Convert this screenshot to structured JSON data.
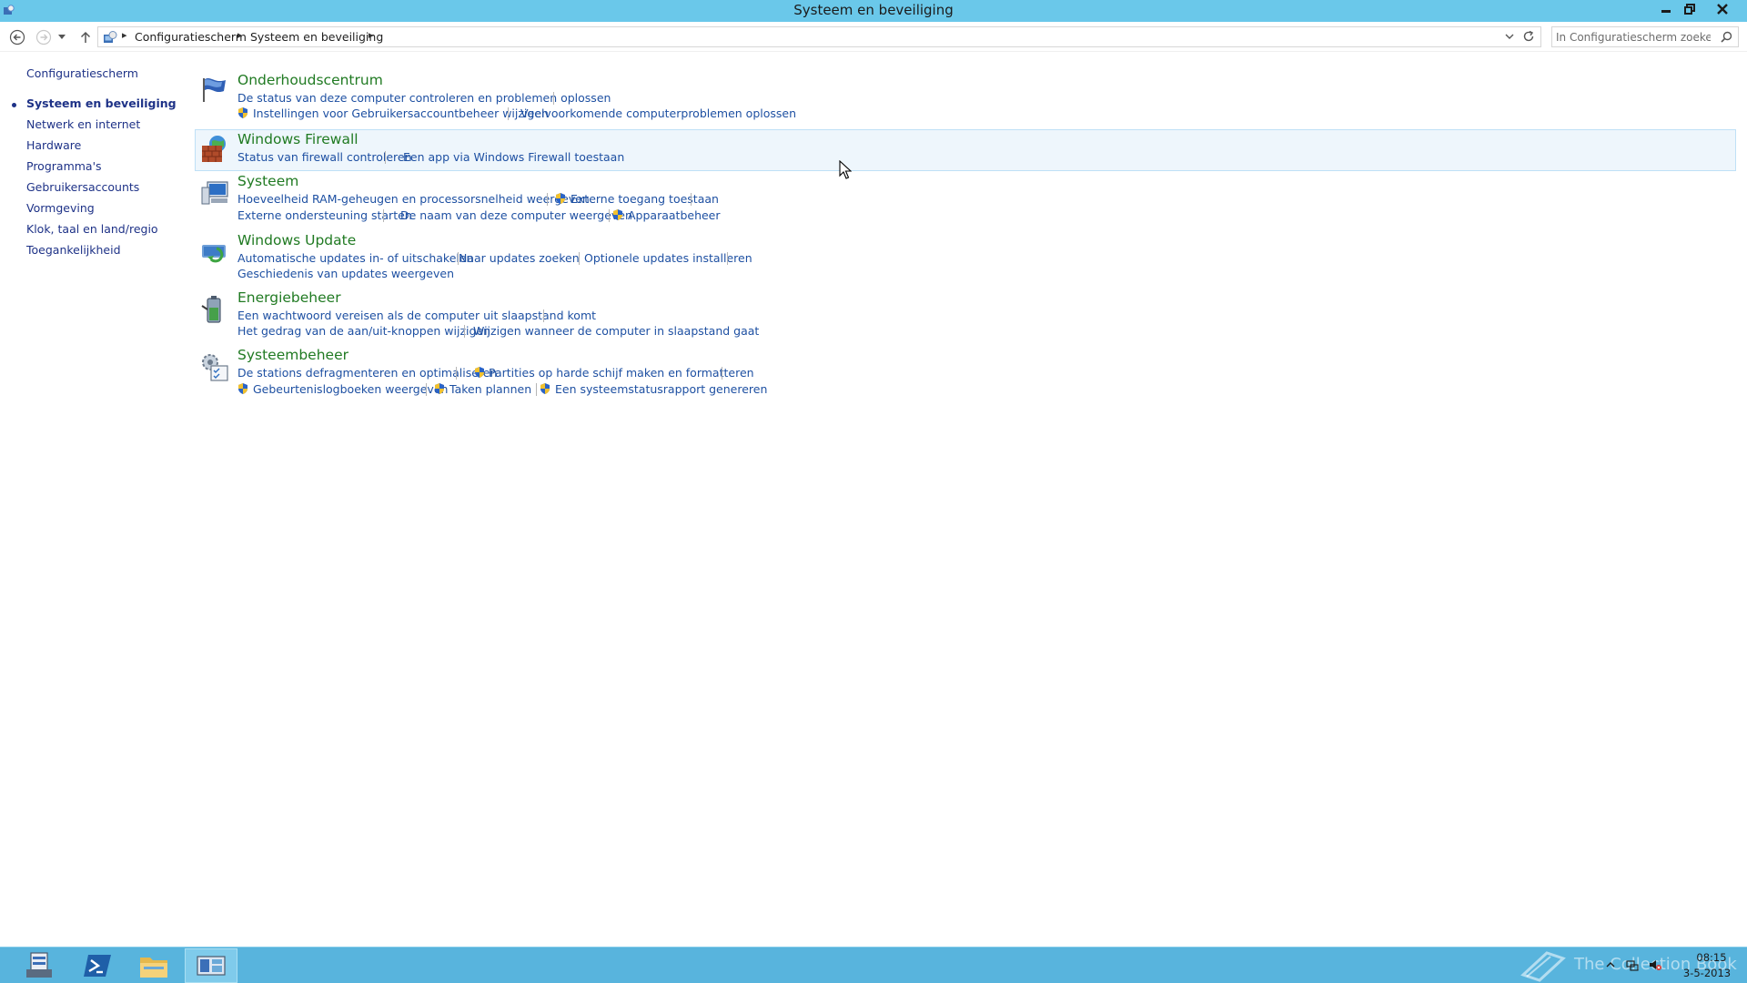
{
  "window": {
    "title": "Systeem en beveiliging"
  },
  "address": {
    "crumbs": [
      "Configuratiescherm",
      "Systeem en beveiliging"
    ],
    "search_placeholder": "In Configuratiescherm zoeken"
  },
  "sidebar": {
    "items": [
      {
        "label": "Configuratiescherm"
      },
      {
        "label": "Systeem en beveiliging",
        "current": true
      },
      {
        "label": "Netwerk en internet"
      },
      {
        "label": "Hardware"
      },
      {
        "label": "Programma's"
      },
      {
        "label": "Gebruikersaccounts"
      },
      {
        "label": "Vormgeving"
      },
      {
        "label": "Klok, taal en land/regio"
      },
      {
        "label": "Toegankelijkheid"
      }
    ]
  },
  "categories": [
    {
      "title": "Onderhoudscentrum",
      "icon": "flag-icon",
      "tasks": [
        "De status van deze computer controleren en problemen oplossen",
        "Instellingen voor Gebruikersaccountbeheer wijzigen",
        "Veelvoorkomende computerproblemen oplossen"
      ]
    },
    {
      "title": "Windows Firewall",
      "icon": "firewall-icon",
      "tasks": [
        "Status van firewall controleren",
        "Een app via Windows Firewall toestaan"
      ]
    },
    {
      "title": "Systeem",
      "icon": "computer-icon",
      "tasks": [
        "Hoeveelheid RAM-geheugen en processorsnelheid weergeven",
        "Externe toegang toestaan",
        "Externe ondersteuning starten",
        "De naam van deze computer weergeven",
        "Apparaatbeheer"
      ]
    },
    {
      "title": "Windows Update",
      "icon": "windows-update-icon",
      "tasks": [
        "Automatische updates in- of uitschakelen",
        "Naar updates zoeken",
        "Optionele updates installeren",
        "Geschiedenis van updates weergeven"
      ]
    },
    {
      "title": "Energiebeheer",
      "icon": "battery-icon",
      "tasks": [
        "Een wachtwoord vereisen als de computer uit slaapstand komt",
        "Het gedrag van de aan/uit-knoppen wijzigen",
        "Wijzigen wanneer de computer in slaapstand gaat"
      ]
    },
    {
      "title": "Systeembeheer",
      "icon": "admin-tools-icon",
      "tasks": [
        "De stations defragmenteren en optimaliseren",
        "Partities op harde schijf maken en formatteren",
        "Gebeurtenislogboeken weergeven",
        "Taken plannen",
        "Een systeemstatusrapport genereren"
      ]
    }
  ],
  "taskbar": {
    "apps": [
      "server-manager-icon",
      "powershell-icon",
      "file-explorer-icon",
      "control-panel-icon"
    ],
    "watermark": "The Collection Book",
    "clock_time": "08:15",
    "clock_date": "3-5-2013"
  },
  "colors": {
    "titlebar": "#6ac8ea",
    "taskbar": "#58b4dd",
    "category_title": "#207a22",
    "task_link": "#1e50a2",
    "nav_link": "#1e3287"
  }
}
